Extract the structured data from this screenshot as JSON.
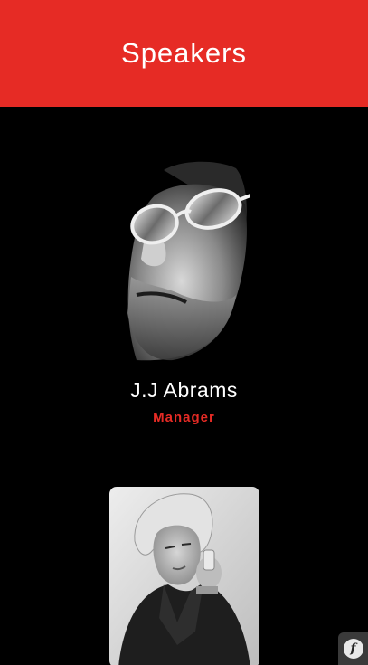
{
  "header": {
    "title": "Speakers"
  },
  "speakers": [
    {
      "name": "J.J Abrams",
      "role": "Manager",
      "photo_icon": "speaker-portrait-man-sunglasses"
    },
    {
      "name": "",
      "role": "",
      "photo_icon": "speaker-portrait-woman"
    }
  ],
  "fab": {
    "icon": "symfony-icon",
    "glyph": "f"
  },
  "colors": {
    "accent": "#e62b25",
    "background": "#000000",
    "text": "#ffffff"
  }
}
